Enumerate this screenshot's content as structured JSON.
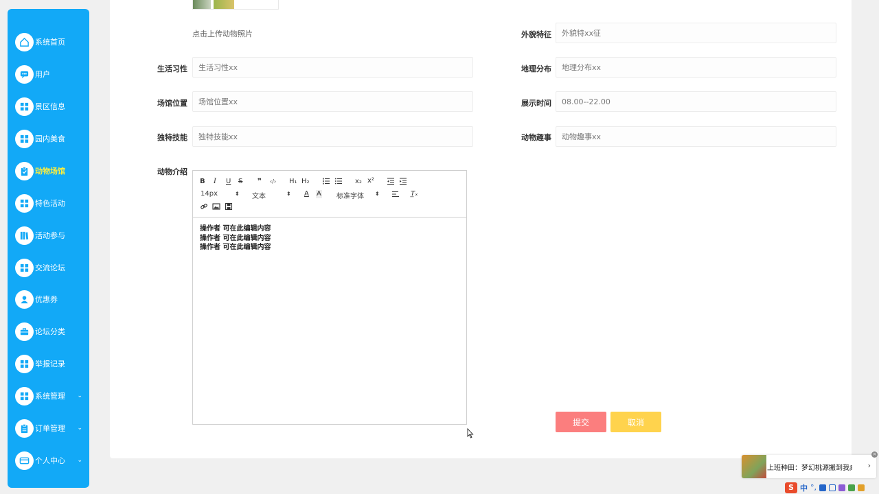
{
  "sidebar": {
    "items": [
      {
        "label": "系统首页",
        "icon": "home-icon"
      },
      {
        "label": "用户",
        "icon": "chat-icon"
      },
      {
        "label": "景区信息",
        "icon": "grid-icon"
      },
      {
        "label": "园内美食",
        "icon": "grid-icon"
      },
      {
        "label": "动物场馆",
        "icon": "clipboard-icon",
        "active": true
      },
      {
        "label": "特色活动",
        "icon": "grid-icon"
      },
      {
        "label": "活动参与",
        "icon": "library-icon"
      },
      {
        "label": "交流论坛",
        "icon": "grid-icon"
      },
      {
        "label": "优惠券",
        "icon": "user-icon"
      },
      {
        "label": "论坛分类",
        "icon": "briefcase-icon"
      },
      {
        "label": "举报记录",
        "icon": "grid-icon"
      },
      {
        "label": "系统管理",
        "icon": "grid-icon",
        "expandable": true
      },
      {
        "label": "订单管理",
        "icon": "clipboard-icon",
        "expandable": true
      },
      {
        "label": "个人中心",
        "icon": "card-icon",
        "expandable": true
      }
    ]
  },
  "form": {
    "upload_hint": "点击上传动物照片",
    "fields": {
      "appearance": {
        "label": "外貌特征",
        "value": "外貌特xx征"
      },
      "habits": {
        "label": "生活习性",
        "value": "生活习性xx"
      },
      "distribution": {
        "label": "地理分布",
        "value": "地理分布xx"
      },
      "location": {
        "label": "场馆位置",
        "value": "场馆位置xx"
      },
      "show_time": {
        "label": "展示时间",
        "value": "08.00--22.00"
      },
      "skills": {
        "label": "独特技能",
        "value": "独特技能xx"
      },
      "fun_facts": {
        "label": "动物趣事",
        "value": "动物趣事xx"
      },
      "intro": {
        "label": "动物介绍"
      }
    },
    "editor": {
      "font_size": "14px",
      "paragraph": "文本",
      "font_family": "标准字体",
      "toolbar": {
        "bold": "B",
        "italic": "I",
        "underline": "U",
        "strike": "S",
        "quote": "❞",
        "code": "‹/›",
        "h1": "H₁",
        "h2": "H₂",
        "sub": "x₂",
        "sup": "x²",
        "clear": "T̲ₓ"
      },
      "content_lines": [
        "操作者 可在此编辑内容",
        "操作者 可在此编辑内容",
        "操作者 可在此编辑内容"
      ]
    },
    "buttons": {
      "submit": "提交",
      "cancel": "取消"
    }
  },
  "notification": {
    "text": "上班种田：梦幻桃源搬到我桌面！",
    "arrow": "›",
    "close": "×"
  },
  "tray": {
    "logo": "S",
    "ime": "中",
    "dots": "°,"
  },
  "colors": {
    "sidebar_bg": "#12a9f7",
    "active_text": "#ffef3d",
    "submit": "#fb7e7e",
    "cancel": "#ffd34d"
  }
}
